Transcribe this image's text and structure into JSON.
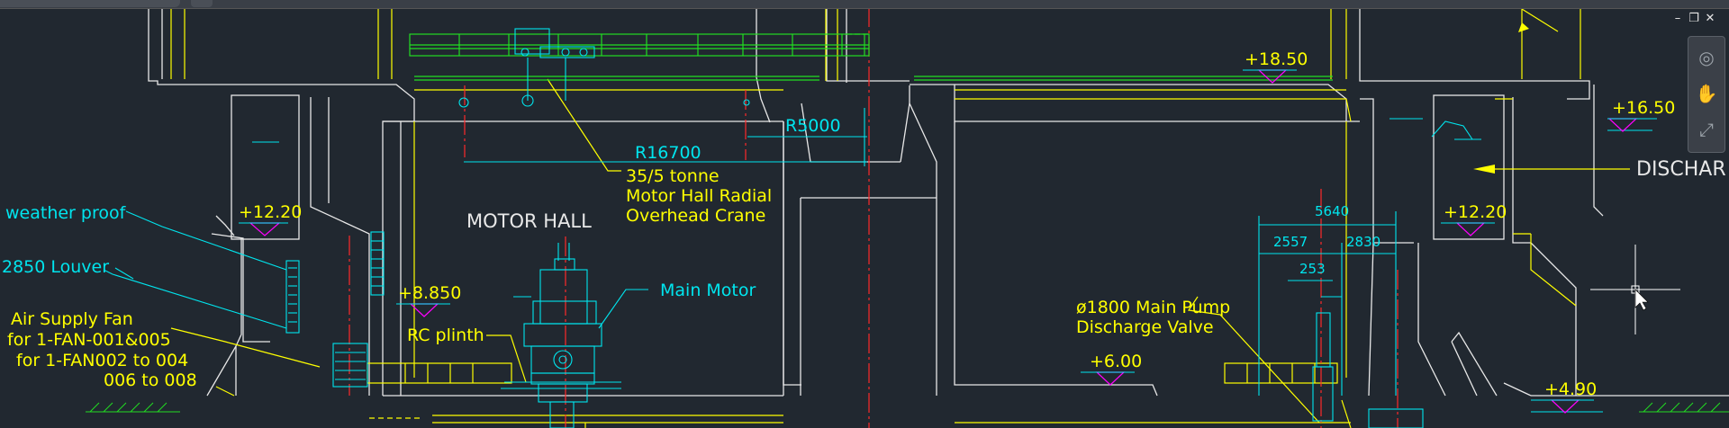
{
  "window": {
    "controls": {
      "minimize": "–",
      "restore": "❐",
      "close": "✕"
    }
  },
  "drawing": {
    "labels": {
      "motor_hall": "MOTOR HALL",
      "r16700": "R16700",
      "r5000": "R5000",
      "crane_line1": "35/5 tonne",
      "crane_line2": "Motor Hall Radial",
      "crane_line3": "Overhead Crane",
      "main_motor": "Main Motor",
      "rc_plinth": "RC plinth",
      "weather_proof": "weather proof",
      "louver": "2850 Louver",
      "fan_line1": "Air Supply Fan",
      "fan_line2": "for 1-FAN-001&005",
      "fan_line3": "for 1-FAN002 to 004",
      "fan_line4": "006 to 008",
      "valve_line1": "ø1800 Main Pump",
      "valve_line2": "Discharge Valve",
      "discharge": "DISCHAR"
    },
    "levels": {
      "l1850": "+18.50",
      "l1650": "+16.50",
      "l1220a": "+12.20",
      "l1220b": "+12.20",
      "l8850": "+8.850",
      "l600": "+6.00",
      "l490": "+4.90"
    },
    "dims": {
      "d5640": "5640",
      "d2557": "2557",
      "d2830": "2830",
      "d253": "253"
    },
    "colors": {
      "background": "#212830",
      "white": "#ffffff",
      "yellow": "#ffff00",
      "cyan": "#00e5ee",
      "green": "#22dd22",
      "red": "#ff2222",
      "magenta": "#ff00ff",
      "gray": "#8a8f96"
    }
  }
}
